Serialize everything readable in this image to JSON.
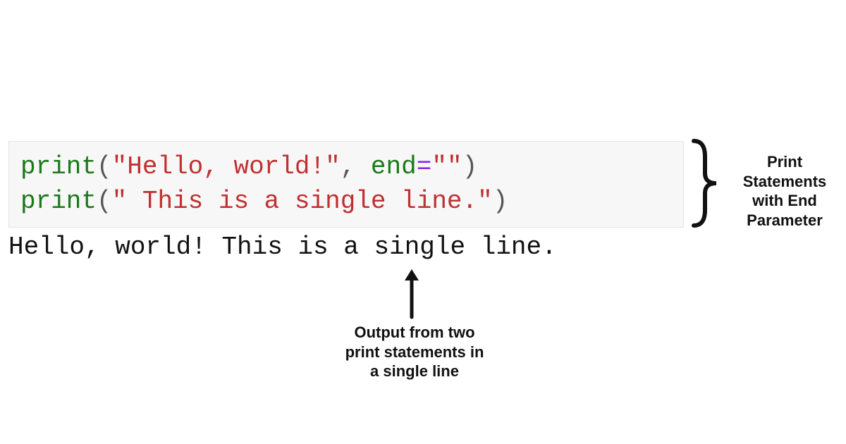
{
  "code": {
    "line1": {
      "func": "print",
      "open": "(",
      "str1": "\"Hello, world!\"",
      "comma": ", ",
      "kw": "end",
      "eq": "=",
      "str2": "\"\"",
      "close": ")"
    },
    "line2": {
      "func": "print",
      "open": "(",
      "str": "\" This is a single line.\"",
      "close": ")"
    }
  },
  "output": "Hello, world! This is a single line.",
  "annotations": {
    "right": "Print Statements with End Parameter",
    "bottom": "Output from two print statements in a single line"
  }
}
